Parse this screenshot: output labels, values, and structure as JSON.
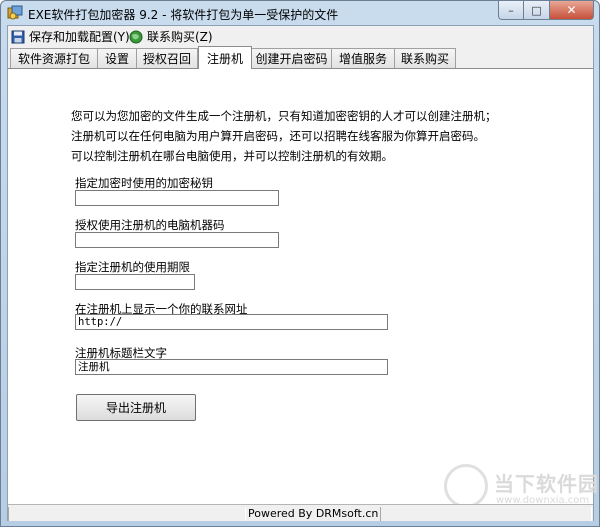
{
  "window": {
    "title": "EXE软件打包加密器 9.2 - 将软件打包为单一受保护的文件"
  },
  "window_buttons": {
    "minimize": "–",
    "maximize": "□",
    "close": "✕"
  },
  "menu": [
    {
      "label": "保存和加载配置(Y)",
      "icon": "save-icon"
    },
    {
      "label": "联系购买(Z)",
      "icon": "globe-icon"
    }
  ],
  "tabs": [
    {
      "label": "软件资源打包",
      "active": false
    },
    {
      "label": "设置",
      "active": false
    },
    {
      "label": "授权召回",
      "active": false
    },
    {
      "label": "注册机",
      "active": true
    },
    {
      "label": "创建开启密码",
      "active": false
    },
    {
      "label": "增值服务",
      "active": false
    },
    {
      "label": "联系购买",
      "active": false
    }
  ],
  "panel": {
    "description": [
      "您可以为您加密的文件生成一个注册机，只有知道加密密钥的人才可以创建注册机；",
      "注册机可以在任何电脑为用户算开启密码，还可以招聘在线客服为你算开启密码。",
      "可以控制注册机在哪台电脑使用，并可以控制注册机的有效期。"
    ],
    "fields": [
      {
        "label": "指定加密时使用的加密秘钥",
        "value": ""
      },
      {
        "label": "授权使用注册机的电脑机器码",
        "value": ""
      },
      {
        "label": "指定注册机的使用期限",
        "value": ""
      },
      {
        "label": "在注册机上显示一个你的联系网址",
        "value": "http://"
      },
      {
        "label": "注册机标题栏文字",
        "value": "注册机"
      }
    ],
    "export_button": "导出注册机"
  },
  "status": {
    "text": "Powered By DRMsoft.cn"
  },
  "watermark": {
    "brand": "当下软件园",
    "url": "www.downxia.com"
  }
}
